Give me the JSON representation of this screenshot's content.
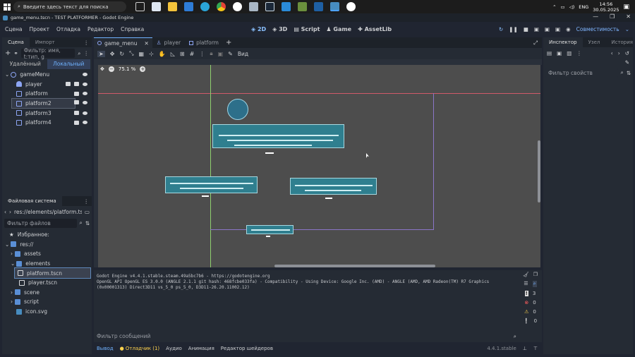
{
  "taskbar": {
    "search_placeholder": "Введите здесь текст для поиска",
    "lang": "ENG",
    "time": "14:56",
    "date": "30.05.2025"
  },
  "window": {
    "title": "game_menu.tscn - TEST PLATFORMER - Godot Engine",
    "controls": [
      "—",
      "❐",
      "✕"
    ]
  },
  "menubar": {
    "items": [
      "Сцена",
      "Проект",
      "Отладка",
      "Редактор",
      "Справка"
    ],
    "workspaces": [
      "2D",
      "3D",
      "Script",
      "Game",
      "AssetLib"
    ],
    "active_workspace": "2D",
    "renderer": "Совместимость"
  },
  "scene_dock": {
    "tabs": [
      "Сцена",
      "Импорт"
    ],
    "filter_placeholder": "Фильтр: имя, t:тип, g",
    "mode_tabs": [
      "Удалённый",
      "Локальный"
    ],
    "nodes": [
      {
        "name": "gameMenu",
        "depth": 0,
        "color": "#8da5f3"
      },
      {
        "name": "player",
        "depth": 1,
        "color": "#8da5f3"
      },
      {
        "name": "platform",
        "depth": 1,
        "color": "#8da5f3"
      },
      {
        "name": "platform2",
        "depth": 1,
        "color": "#8da5f3",
        "selected": true
      },
      {
        "name": "platform3",
        "depth": 1,
        "color": "#8da5f3"
      },
      {
        "name": "platform4",
        "depth": 1,
        "color": "#8da5f3"
      }
    ]
  },
  "filesystem_dock": {
    "title": "Файловая система",
    "path": "res://elements/platform.ts",
    "filter_placeholder": "Фильтр файлов",
    "items": [
      {
        "name": "Избранное:",
        "depth": 0,
        "icon": "star-icon"
      },
      {
        "name": "res://",
        "depth": 0,
        "icon": "folder-icon"
      },
      {
        "name": "assets",
        "depth": 1,
        "icon": "folder-icon"
      },
      {
        "name": "elements",
        "depth": 1,
        "icon": "folder-icon"
      },
      {
        "name": "platform.tscn",
        "depth": 2,
        "icon": "scene-icon",
        "selected": true
      },
      {
        "name": "player.tscn",
        "depth": 2,
        "icon": "scene-icon"
      },
      {
        "name": "scene",
        "depth": 1,
        "icon": "folder-icon"
      },
      {
        "name": "script",
        "depth": 1,
        "icon": "folder-icon"
      },
      {
        "name": "icon.svg",
        "depth": 1,
        "icon": "image-icon"
      }
    ]
  },
  "editor_tabs": [
    "game_menu",
    "player",
    "platform"
  ],
  "toolbar": {
    "view_label": "Вид",
    "zoom": "75.1 %"
  },
  "inspector": {
    "tabs": [
      "Инспектор",
      "Узел",
      "История"
    ],
    "filter_placeholder": "Фильтр свойств"
  },
  "output": {
    "lines": [
      "Godot Engine v4.4.1.stable.steam.49a5bc7b6 - https://godotengine.org",
      "OpenGL API OpenGL ES 3.0.0 (ANGLE 2.1.1 git hash: 468fcbe033fa) - Compatibility - Using Device: Google Inc. (AMD) - ANGLE (AMD, AMD Radeon(TM) R7 Graphics",
      "(0x00001313) Direct3D11 vs_5_0 ps_5_0, D3D11-26.20.11002.12)"
    ],
    "filter_placeholder": "Фильтр сообщений",
    "counts": {
      "messages": "3",
      "errors": "0",
      "warnings": "0",
      "info": "0"
    }
  },
  "bottom_tabs": [
    "Вывод",
    "Отладчик (1)",
    "Аудио",
    "Анимация",
    "Редактор шейдеров"
  ],
  "version": "4.4.1.stable"
}
